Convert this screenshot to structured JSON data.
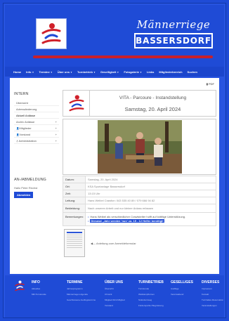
{
  "header": {
    "title_script": "Männerriege",
    "title_box": "BASSERSDORF",
    "logo_icon": "mr-logo-icon"
  },
  "nav": [
    {
      "label": "Home",
      "caret": false
    },
    {
      "label": "Info",
      "caret": true
    },
    {
      "label": "Termine",
      "caret": true
    },
    {
      "label": "Über uns",
      "caret": true
    },
    {
      "label": "Turnbetrieb",
      "caret": true
    },
    {
      "label": "Geselligkeit",
      "caret": true
    },
    {
      "label": "Fotogalerie",
      "caret": true
    },
    {
      "label": "Links",
      "caret": false
    },
    {
      "label": "Mitgliederbereich",
      "caret": false
    },
    {
      "label": "Suchen",
      "caret": false
    }
  ],
  "content": {
    "pdf_label": "PDF"
  },
  "sidebar": {
    "title": "INTERN",
    "items": [
      {
        "label": "Übersicht",
        "plus": false,
        "icon": ""
      },
      {
        "label": "Adressänderung",
        "plus": false,
        "icon": ""
      },
      {
        "label": "Aktuell Anlässe",
        "plus": false,
        "icon": ""
      },
      {
        "label": "Archiv Anlässe",
        "plus": true,
        "icon": ""
      },
      {
        "label": "Mitglieder",
        "plus": true,
        "icon": "user-icon"
      },
      {
        "label": "Vorstand",
        "plus": true,
        "icon": "user-icon"
      },
      {
        "label": "Administration",
        "plus": true,
        "icon": "key-icon"
      }
    ],
    "login_title": "AN-/ABMELDUNG",
    "hello": "Hallo Peter Rechst",
    "logout": "Abmelden"
  },
  "event": {
    "title": "VITA - Parcoure - Instandstellung",
    "date_headline": "Samstag, 20. April 2024",
    "rows": [
      {
        "label": "Datum:",
        "value": "Samstag, 20. April 2024"
      },
      {
        "label": "Ort:",
        "value": "KSA Sportanlage Bassersdorf"
      },
      {
        "label": "Zeit:",
        "value": "13:15 Uhr"
      },
      {
        "label": "Leitung:",
        "value": "Hans Weibel Crawfon: 043 535 40 89 / 079 666 94 82"
      },
      {
        "label": "Bekleidung:",
        "value": "Nach unseren Arbeit und nur kleiner Anlass erfassen"
      }
    ],
    "remarks_label": "Bemerkungen:",
    "remarks": [
      {
        "text": "Hans Weibel als verschiedlicher Crawlstelter hofft auf kräftige Unterstützung.",
        "highlight": false
      },
      {
        "text": "Diesmal „Jahr werden 'nun' ca. 15 - 12 Helfer benötigt!",
        "highlight": true
      }
    ],
    "attachment_label": "Anleitung zum Anmeldeformular"
  },
  "footer": {
    "columns": [
      {
        "head": "INFO",
        "links": [
          "Aktuelles",
          "MR-Turnstunde"
        ]
      },
      {
        "head": "TERMINE",
        "links": [
          "Jahresprogramm",
          "Männerriegen-Agenda",
          "Geschlossene Ausflugstermine"
        ]
      },
      {
        "head": "ÜBER UNS",
        "links": [
          "Übersicht",
          "Chronik",
          "Mitglied-Wird Mitglied",
          "Vorstand"
        ]
      },
      {
        "head": "TURNBETRIEB",
        "links": [
          "Turnstunde",
          "Wettkampfturnen",
          "Stufenlernweg",
          "Fördersportler Begrüssung"
        ]
      },
      {
        "head": "GESELLIGES",
        "links": [
          "Ausflüge",
          "Vereinsabend"
        ]
      },
      {
        "head": "DIVERSES",
        "links": [
          "Impressum",
          "Kontakt",
          "Turnhallen-Reservation",
          "Veranstaltungen"
        ]
      }
    ]
  },
  "colors": {
    "brand_blue": "#1f4bd6",
    "accent_red": "#c8202a"
  }
}
